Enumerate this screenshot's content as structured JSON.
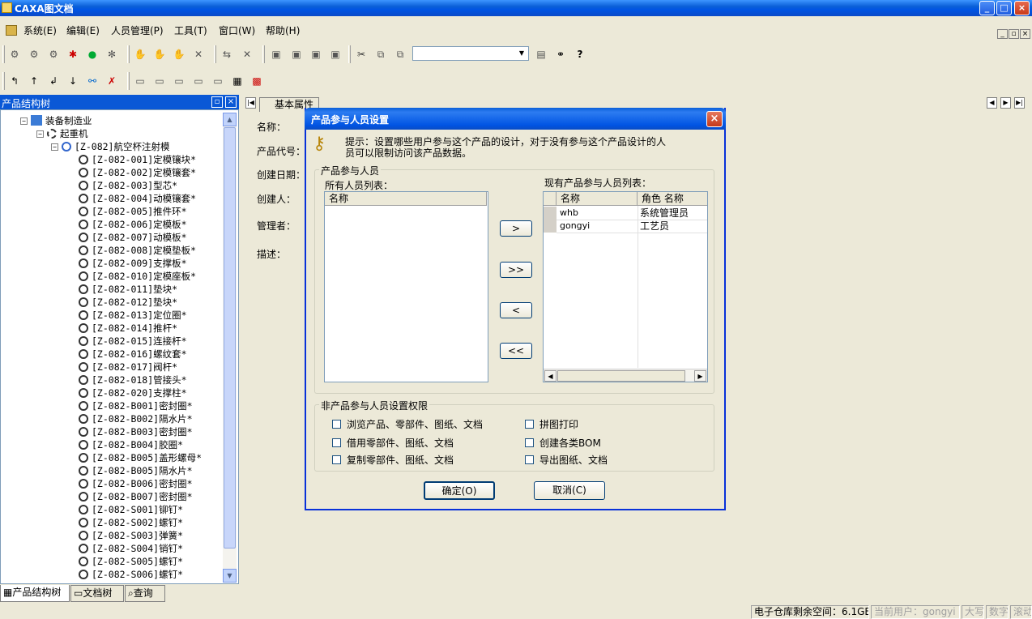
{
  "window": {
    "title": "CAXA图文档"
  },
  "menu": [
    "系统(E)",
    "编辑(E)",
    "人员管理(P)",
    "工具(T)",
    "窗口(W)",
    "帮助(H)"
  ],
  "left_panel": {
    "title": "产品结构树",
    "root": "装备制造业",
    "level1": "起重机",
    "level2": "[Z-082]航空杯注射模",
    "items": [
      "[Z-082-001]定模镶块*",
      "[Z-082-002]定模镶套*",
      "[Z-082-003]型芯*",
      "[Z-082-004]动模镶套*",
      "[Z-082-005]推件环*",
      "[Z-082-006]定模板*",
      "[Z-082-007]动模板*",
      "[Z-082-008]定模垫板*",
      "[Z-082-009]支撑板*",
      "[Z-082-010]定模座板*",
      "[Z-082-011]垫块*",
      "[Z-082-012]垫块*",
      "[Z-082-013]定位圈*",
      "[Z-082-014]推杆*",
      "[Z-082-015]连接杆*",
      "[Z-082-016]螺纹套*",
      "[Z-082-017]阀杆*",
      "[Z-082-018]管接头*",
      "[Z-082-020]支撑柱*",
      "[Z-082-B001]密封圈*",
      "[Z-082-B002]隔水片*",
      "[Z-082-B003]密封圈*",
      "[Z-082-B004]胶圈*",
      "[Z-082-B005]盖形螺母*",
      "[Z-082-B005]隔水片*",
      "[Z-082-B006]密封圈*",
      "[Z-082-B007]密封圈*",
      "[Z-082-S001]铆钉*",
      "[Z-082-S002]螺钉*",
      "[Z-082-S003]弹簧*",
      "[Z-082-S004]销钉*",
      "[Z-082-S005]螺钉*",
      "[Z-082-S006]螺钉*"
    ],
    "tabs": [
      "产品结构树",
      "文档树",
      "查询"
    ]
  },
  "right_panel": {
    "tab": "基本属性",
    "fields": [
      "名称：",
      "产品代号：",
      "创建日期：",
      "创建人：",
      "管理者：",
      "描述："
    ]
  },
  "dialog": {
    "title": "产品参与人员设置",
    "hint": "提示：设置哪些用户参与这个产品的设计，对于没有参与这个产品设计的人",
    "hint2": "员可以限制访问该产品数据。",
    "group1": "产品参与人员",
    "all_label": "所有人员列表：",
    "all_col": "名称",
    "current_label": "现有产品参与人员列表：",
    "current_cols": [
      "名称",
      "角色 名称"
    ],
    "current_rows": [
      {
        "name": "whb",
        "role": "系统管理员"
      },
      {
        "name": "gongyi",
        "role": "工艺员"
      }
    ],
    "move_buttons": [
      ">",
      ">>",
      "<",
      "<<"
    ],
    "group2": "非产品参与人员设置权限",
    "checks": [
      "浏览产品、零部件、图纸、文档",
      "借用零部件、图纸、文档",
      "复制零部件、图纸、文档",
      "拼图打印",
      "创建各类BOM",
      "导出图纸、文档"
    ],
    "ok": "确定(O)",
    "cancel": "取消(C)"
  },
  "status": {
    "space": "电子仓库剩余空间：6.1GB",
    "user": "当前用户：gongyi",
    "caps": "大写",
    "num": "数字",
    "scroll": "滚动"
  }
}
